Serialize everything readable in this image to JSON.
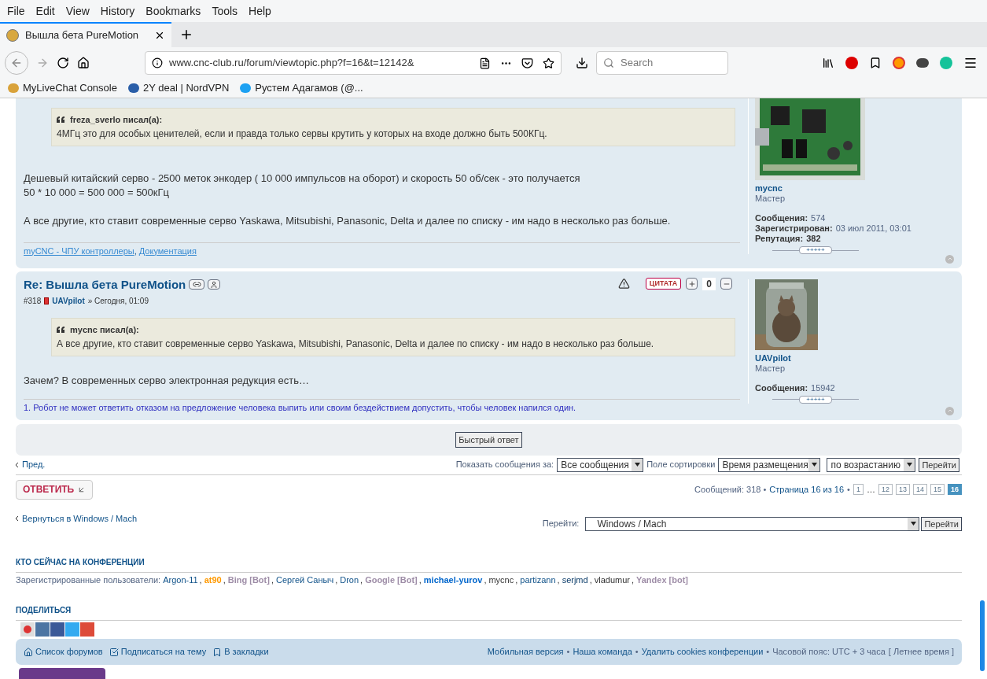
{
  "menu": [
    "File",
    "Edit",
    "View",
    "History",
    "Bookmarks",
    "Tools",
    "Help"
  ],
  "tab": {
    "title": "Вышла бета PureMotion",
    "selected": true
  },
  "address": {
    "url": "www.cnc-club.ru/forum/viewtopic.php?f=16&t=12142&",
    "search_placeholder": "Search"
  },
  "bookmarks": [
    "MyLiveChat Console",
    "2Y deal | NordVPN",
    "Рустем Адагамов (@..."
  ],
  "posts": [
    {
      "quote": {
        "author": "freza_sverlo писал(а):",
        "text": "4МГц это для особых ценителей, если и правда только сервы крутить у которых на входе должно быть 500КГц."
      },
      "paragraphs": [
        "Дешевый китайский серво - 2500 меток энкодер ( 10 000 импульсов на оборот) и скорость 50 об/сек - это получается\n50 * 10 000 = 500 000 = 500кГц",
        "А все другие, кто ставит современные серво Yaskawa, Mitsubishi, Panasonic, Delta и далее по списку - им надо в несколько раз больше."
      ],
      "signature": {
        "kind": "links",
        "links": [
          "myCNC - ЧПУ контроллеры",
          "Документация"
        ],
        "separator": ","
      },
      "profile": {
        "name": "mycnc",
        "rank": "Мастер",
        "stats": [
          {
            "label": "Сообщения:",
            "value": "574",
            "bold": false
          },
          {
            "label": "Зарегистрирован:",
            "value": "03 июл 2011, 03:01",
            "bold": false
          },
          {
            "label": "Репутация:",
            "value": "382",
            "bold": true
          }
        ],
        "rep": "+++++"
      }
    },
    {
      "title": "Re: Вышла бета PureMotion",
      "number": "#318",
      "author": "UAVpilot",
      "time": "» Сегодня, 01:09",
      "quote_button": "ЦИТАТА",
      "score": "0",
      "quote": {
        "author": "mycnc писал(а):",
        "text": "А все другие, кто ставит современные серво Yaskawa, Mitsubishi, Panasonic, Delta и далее по списку - им надо в несколько раз больше."
      },
      "paragraphs": [
        "Зачем? В современных серво электронная редукция есть…"
      ],
      "signature": {
        "kind": "text",
        "text": "1. Робот не может ответить отказом на предложение человека выпить или своим бездействием допустить, чтобы человек напился один."
      },
      "profile": {
        "name": "UAVpilot",
        "rank": "Мастер",
        "stats": [
          {
            "label": "Сообщения:",
            "value": "15942",
            "bold": false
          }
        ],
        "rep": "+++++"
      }
    }
  ],
  "quick_reply": "Быстрый ответ",
  "topic_nav": {
    "prev": "Пред.",
    "show_label": "Показать сообщения за:",
    "show_value": "Все сообщения",
    "sort_label": "Поле сортировки",
    "sort_value": "Время размещения",
    "order_value": "по возрастанию",
    "go": "Перейти"
  },
  "reply_button": "ОТВЕТИТЬ",
  "pagination": {
    "summary": "Сообщений: 318 •",
    "page_text": "Страница 16 из 16",
    "bullet": "•",
    "pages": [
      {
        "label": "1",
        "selected": false
      },
      {
        "label": "…",
        "kind": "gap"
      },
      {
        "label": "12",
        "selected": false
      },
      {
        "label": "13",
        "selected": false
      },
      {
        "label": "14",
        "selected": false
      },
      {
        "label": "15",
        "selected": false
      },
      {
        "label": "16",
        "selected": true
      }
    ]
  },
  "back_link": "Вернуться в Windows / Mach",
  "jump": {
    "label": "Перейти:",
    "value": "Windows / Mach",
    "button": "Перейти"
  },
  "online": {
    "heading": "КТО СЕЙЧАС НА КОНФЕРЕНЦИИ",
    "label": "Зарегистрированные пользователи:",
    "separator": ",",
    "users": [
      {
        "name": "Argon-11",
        "color": "#105289",
        "bold": false
      },
      {
        "name": "at90",
        "color": "#ff9900",
        "bold": true
      },
      {
        "name": "Bing [Bot]",
        "color": "#9e8da7",
        "bold": true
      },
      {
        "name": "Сергей Саныч",
        "color": "#105289",
        "bold": false
      },
      {
        "name": "Dron",
        "color": "#105289",
        "bold": false
      },
      {
        "name": "Google [Bot]",
        "color": "#9e8da7",
        "bold": true
      },
      {
        "name": "michael-yurov",
        "color": "#0066cc",
        "bold": true
      },
      {
        "name": "mycnc",
        "color": "#333333",
        "bold": false
      },
      {
        "name": "partizann",
        "color": "#105289",
        "bold": false
      },
      {
        "name": "serjmd",
        "color": "#0c3d6a",
        "bold": false
      },
      {
        "name": "vladumur",
        "color": "#333333",
        "bold": false
      },
      {
        "name": "Yandex [bot]",
        "color": "#9e8da7",
        "bold": true
      }
    ]
  },
  "share": {
    "heading": "ПОДЕЛИТЬСЯ"
  },
  "footer": {
    "left": [
      "Список форумов",
      "Подписаться на тему",
      "В закладки"
    ],
    "right": [
      "Мобильная версия",
      "Наша команда",
      "Удалить cookies конференции"
    ],
    "bullet": "•",
    "timezone": "Часовой пояс: UTC + 3 часа",
    "dst": "[ Летнее время ]"
  }
}
